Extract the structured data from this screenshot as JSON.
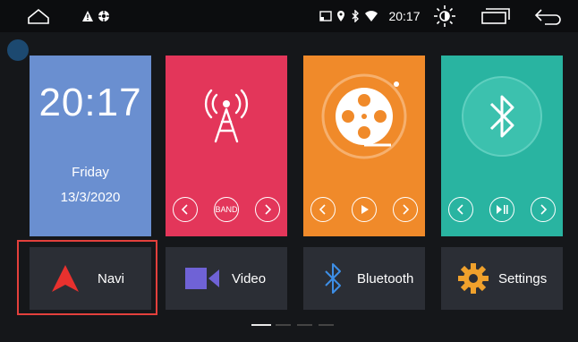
{
  "status_bar": {
    "time": "20:17",
    "left_icons": [
      "home-icon",
      "warning-icon",
      "settings-gear-icon"
    ],
    "right_icons": [
      "cast-icon",
      "location-icon",
      "bluetooth-icon",
      "wifi-icon",
      "brightness-icon",
      "recent-apps-icon",
      "back-icon"
    ]
  },
  "clock_widget": {
    "time": "20:17",
    "day": "Friday",
    "date": "13/3/2020"
  },
  "radio_widget": {
    "icon": "radio-antenna-icon",
    "band_label": "BAND"
  },
  "video_widget": {
    "icon": "film-reel-icon"
  },
  "bluetooth_widget": {
    "icon": "bluetooth-icon"
  },
  "apps": [
    {
      "label": "Navi",
      "icon": "navigation-arrow-icon",
      "selected": true
    },
    {
      "label": "Video",
      "icon": "video-camera-icon"
    },
    {
      "label": "Bluetooth",
      "icon": "bluetooth-icon"
    },
    {
      "label": "Settings",
      "icon": "gear-icon"
    }
  ],
  "page_indicator": {
    "pages": 4,
    "active": 1
  },
  "colors": {
    "clock": "#6a8fd0",
    "radio": "#e3365a",
    "video": "#f08a2a",
    "bluetooth": "#29b4a1",
    "selection": "#e3403c"
  }
}
